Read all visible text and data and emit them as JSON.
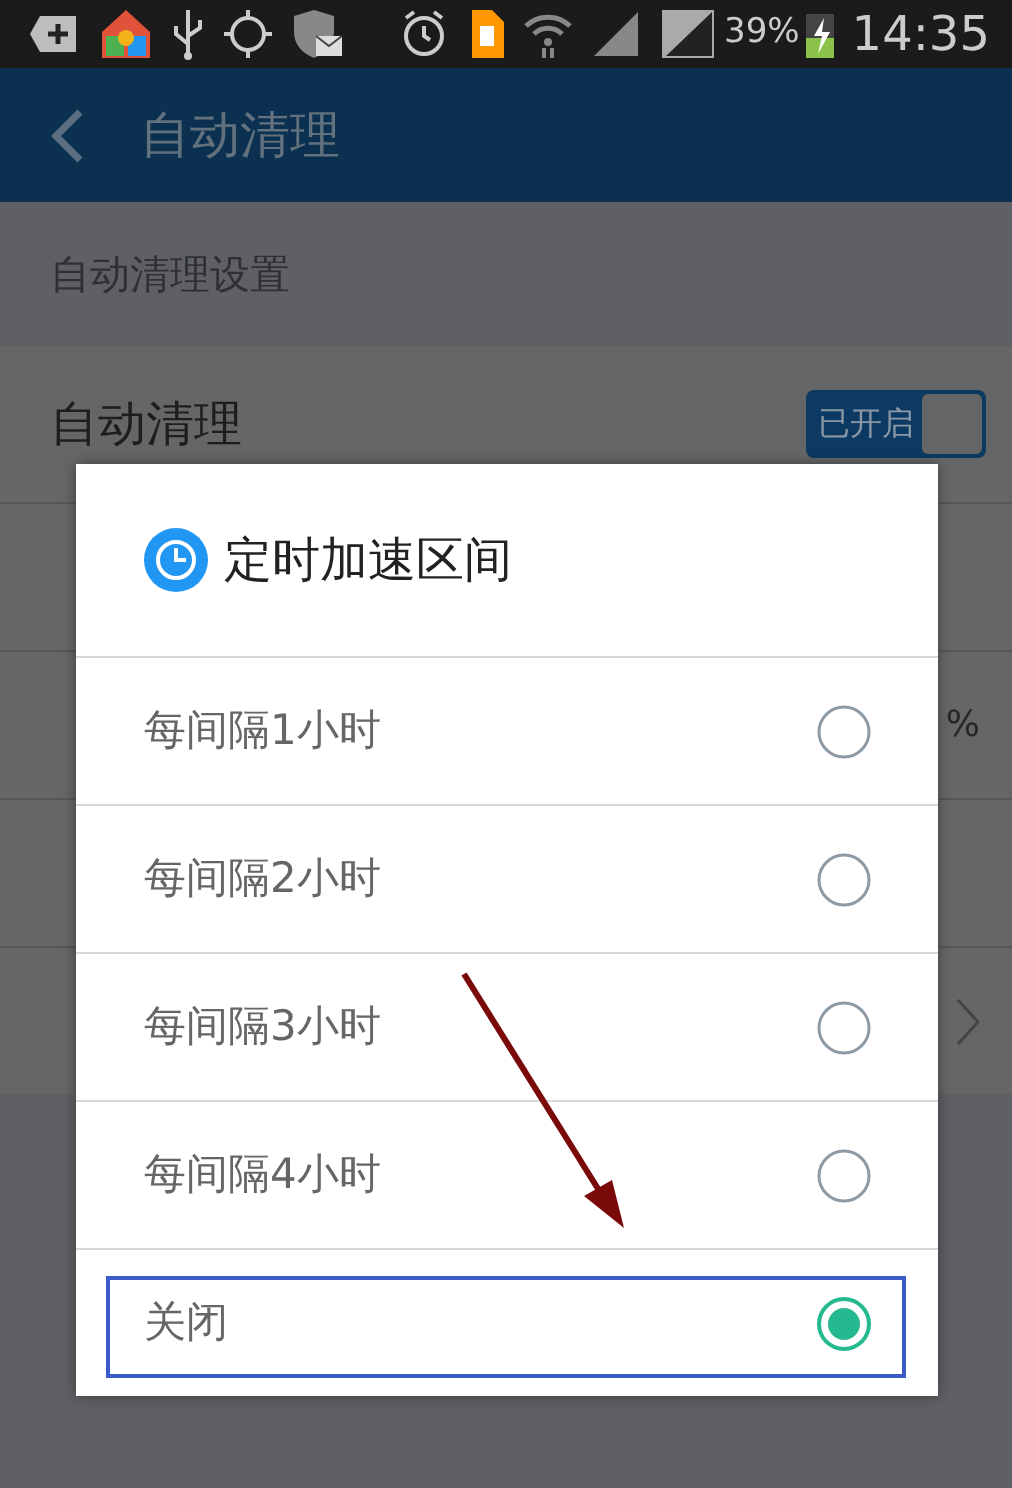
{
  "status_bar": {
    "battery": "39%",
    "time": "14:35"
  },
  "app_bar": {
    "title": "自动清理"
  },
  "section_header": "自动清理设置",
  "auto_clean": {
    "label": "自动清理",
    "toggle_label": "已开启",
    "on": true
  },
  "background_rows": [
    {
      "kind": "blank"
    },
    {
      "kind": "value",
      "value": "%"
    },
    {
      "kind": "blank"
    },
    {
      "kind": "chevron"
    }
  ],
  "dialog": {
    "title": "定时加速区间",
    "options": [
      {
        "label": "每间隔1小时",
        "selected": false
      },
      {
        "label": "每间隔2小时",
        "selected": false
      },
      {
        "label": "每间隔3小时",
        "selected": false
      },
      {
        "label": "每间隔4小时",
        "selected": false
      },
      {
        "label": "关闭",
        "selected": true
      }
    ]
  }
}
